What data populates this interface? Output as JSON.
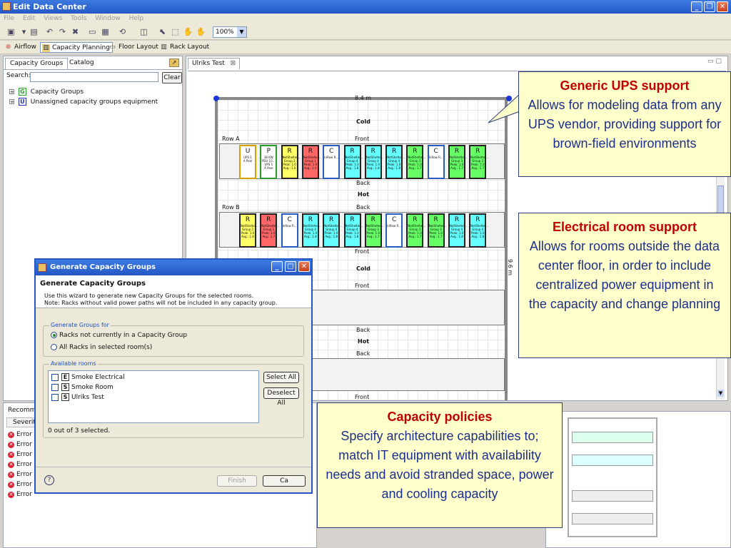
{
  "window": {
    "title": "Edit Data Center"
  },
  "menu": [
    "File",
    "Edit",
    "Views",
    "Tools",
    "Window",
    "Help"
  ],
  "toolbar": {
    "zoom": "100%"
  },
  "perspectives": [
    {
      "label": "Airflow",
      "icon": "airflow-icon"
    },
    {
      "label": "Capacity Planning",
      "icon": "capacity-planning-icon",
      "selected": true
    },
    {
      "label": "Floor Layout",
      "icon": "floor-layout-icon"
    },
    {
      "label": "Rack Layout",
      "icon": "rack-layout-icon"
    }
  ],
  "left_panel": {
    "tabs": [
      "Capacity Groups",
      "Catalog"
    ],
    "search_label": "Search:",
    "clear_label": "Clear",
    "tree": [
      {
        "badge": "G",
        "label": "Capacity Groups",
        "color": "#2a9a2a"
      },
      {
        "badge": "U",
        "label": "Unassigned capacity groups equipment",
        "color": "#2030b0"
      }
    ]
  },
  "editor": {
    "tab": "Ulriks Test",
    "width_label": "8.4 m",
    "height_label": "9.6 m",
    "labels": {
      "cold1": "Cold",
      "front1": "Front",
      "row_a": "Row A",
      "back1": "Back",
      "hot1": "Hot",
      "back2": "Back",
      "row_b": "Row B",
      "front2": "Front",
      "cold2": "Cold",
      "front3": "Front",
      "back3": "Back",
      "hot2": "Hot",
      "back4": "Back",
      "front4": "Front"
    },
    "row_a_racks": [
      {
        "letter": "U",
        "lines": [
          "UPS 1",
          "A Pool"
        ],
        "color": "#ffffff",
        "border": "#d4a000"
      },
      {
        "letter": "P",
        "lines": [
          "38 KW PDU 15...",
          "UPS 1",
          "A Pool"
        ],
        "color": "#ffffff",
        "border": "#2a9a2a"
      },
      {
        "letter": "R",
        "lines": [
          "NetShelter...",
          "Group 2",
          "Peak: 1.0",
          "Avg.: 1.0"
        ],
        "color": "#ffff66",
        "border": "#222"
      },
      {
        "letter": "R",
        "lines": [
          "NetShelter...",
          "Group 1",
          "Peak: 1.0",
          "Avg.: 1.0"
        ],
        "color": "#ff6666",
        "border": "#222"
      },
      {
        "letter": "C",
        "lines": [
          "InRow R..."
        ],
        "color": "#ffffff",
        "border": "#2a5cc0"
      },
      {
        "letter": "R",
        "lines": [
          "NetShelter...",
          "Group 4",
          "Peak: 1.0",
          "Avg.: 1.8"
        ],
        "color": "#66ffff",
        "border": "#222"
      },
      {
        "letter": "R",
        "lines": [
          "NetShelter...",
          "Group 4",
          "Peak: 1.0",
          "Avg.: 1.8"
        ],
        "color": "#66ffff",
        "border": "#222"
      },
      {
        "letter": "R",
        "lines": [
          "NetShelter...",
          "Group 4",
          "Peak: 1.0",
          "Avg.: 1.8"
        ],
        "color": "#66ffff",
        "border": "#222"
      },
      {
        "letter": "R",
        "lines": [
          "NetShelter...",
          "Group 3",
          "Peak: 1.0",
          "Avg.: 1.7"
        ],
        "color": "#66ff66",
        "border": "#222"
      },
      {
        "letter": "C",
        "lines": [
          "InRow R..."
        ],
        "color": "#ffffff",
        "border": "#2a5cc0"
      },
      {
        "letter": "R",
        "lines": [
          "NetShelter...",
          "Group 3",
          "Peak: 1.0",
          "Avg.: 1.7"
        ],
        "color": "#66ff66",
        "border": "#222"
      },
      {
        "letter": "R",
        "lines": [
          "NetShelter...",
          "Group 3",
          "Peak: 1.0",
          "Avg.: 1.7"
        ],
        "color": "#66ff66",
        "border": "#222"
      }
    ],
    "row_b_racks": [
      {
        "letter": "R",
        "lines": [
          "NetShelter...",
          "Group 2",
          "Peak: 1.0",
          "Avg.: 1.8"
        ],
        "color": "#ffff66",
        "border": "#222"
      },
      {
        "letter": "R",
        "lines": [
          "NetShelter...",
          "Group 1",
          "Peak: 1.0",
          "Avg.: 1.7"
        ],
        "color": "#ff6666",
        "border": "#222"
      },
      {
        "letter": "C",
        "lines": [
          "InRow R..."
        ],
        "color": "#ffffff",
        "border": "#2a5cc0"
      },
      {
        "letter": "R",
        "lines": [
          "NetShelter...",
          "Group 4",
          "Peak: 1.0",
          "Avg.: 1.8"
        ],
        "color": "#66ffff",
        "border": "#222"
      },
      {
        "letter": "R",
        "lines": [
          "NetShelter...",
          "Group 4",
          "Peak: 1.0",
          "Avg.: 1.8"
        ],
        "color": "#66ffff",
        "border": "#222"
      },
      {
        "letter": "R",
        "lines": [
          "NetShelter...",
          "Group 4",
          "Peak: 1.0",
          "Avg.: 1.8"
        ],
        "color": "#66ffff",
        "border": "#222"
      },
      {
        "letter": "R",
        "lines": [
          "NetShelter...",
          "Group 3",
          "Peak: 1.0",
          "Avg.: 1.7"
        ],
        "color": "#66ff66",
        "border": "#222"
      },
      {
        "letter": "C",
        "lines": [
          "InRow R..."
        ],
        "color": "#ffffff",
        "border": "#2a5cc0"
      },
      {
        "letter": "R",
        "lines": [
          "NetShelter...",
          "Group 3",
          "Peak: 1.0",
          "Avg.: 1.7"
        ],
        "color": "#66ff66",
        "border": "#222"
      },
      {
        "letter": "R",
        "lines": [
          "NetShelter...",
          "Group 3",
          "Peak: 1.0",
          "Avg.: 1.7"
        ],
        "color": "#66ff66",
        "border": "#222"
      },
      {
        "letter": "R",
        "lines": [
          "NetShelter...",
          "Group 4",
          "Peak: 1.0",
          "Avg.: 1.8"
        ],
        "color": "#66ffff",
        "border": "#222"
      },
      {
        "letter": "R",
        "lines": [
          "NetShelter...",
          "Group 4",
          "Peak: 1.0",
          "Avg.: 1.8"
        ],
        "color": "#66ffff",
        "border": "#222"
      }
    ]
  },
  "bottom_panel": {
    "tab": "Recomme",
    "column": "Severity",
    "rows": [
      "Error",
      "Error",
      "Error",
      "Error",
      "Error",
      "Error",
      "Error"
    ]
  },
  "dialog": {
    "title": "Generate Capacity Groups",
    "heading": "Generate Capacity Groups",
    "desc1": "Use this wizard to generate new Capacity Groups for the selected rooms.",
    "desc2": "Note: Racks without valid power paths will not be included in any capacity group.",
    "group1_label": "Generate Groups for",
    "radio1": "Racks not currently in a Capacity Group",
    "radio2": "All Racks in selected room(s)",
    "group2_label": "Available rooms",
    "rooms": [
      {
        "badge": "E",
        "label": "Smoke Electrical"
      },
      {
        "badge": "S",
        "label": "Smoke Room"
      },
      {
        "badge": "S",
        "label": "Ulriks Test"
      }
    ],
    "select_all": "Select All",
    "deselect_all": "Deselect All",
    "selected_count": "0 out of 3 selected.",
    "finish": "Finish",
    "cancel_partial": "Ca"
  },
  "callouts": {
    "ups": {
      "title": "Generic UPS support",
      "body": "Allows for modeling data from any UPS vendor, providing support for brown-field environments"
    },
    "electrical": {
      "title": "Electrical room support",
      "body": "Allows for rooms outside the data center floor, in order to include centralized power equipment in the capacity and change planning"
    },
    "policies": {
      "title": "Capacity policies",
      "body": "Specify architecture capabilities to; match IT equipment with availability needs and avoid stranded space, power and cooling capacity"
    }
  }
}
